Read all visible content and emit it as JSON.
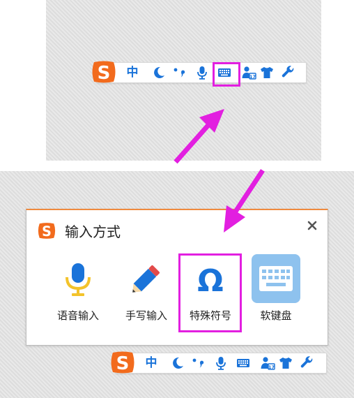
{
  "toolbar": {
    "lang_label": "中",
    "icons": [
      "sogou-logo-icon",
      "half-width-moon-icon",
      "punctuation-icon",
      "microphone-icon",
      "soft-keyboard-icon",
      "user-account-icon",
      "skin-shirt-icon",
      "settings-wrench-icon"
    ]
  },
  "dialog": {
    "title": "输入方式",
    "close_label": "×",
    "options": [
      {
        "label": "语音输入",
        "icon": "microphone-icon"
      },
      {
        "label": "手写输入",
        "icon": "pencil-icon"
      },
      {
        "label": "特殊符号",
        "icon": "omega-icon"
      },
      {
        "label": "软键盘",
        "icon": "keyboard-icon"
      }
    ]
  },
  "colors": {
    "highlight": "#e21fe0",
    "arrow": "#e21fe0",
    "icon_blue": "#1a73d9",
    "logo_orange": "#f26b1d",
    "panel_bg": "#e4e4e4"
  }
}
